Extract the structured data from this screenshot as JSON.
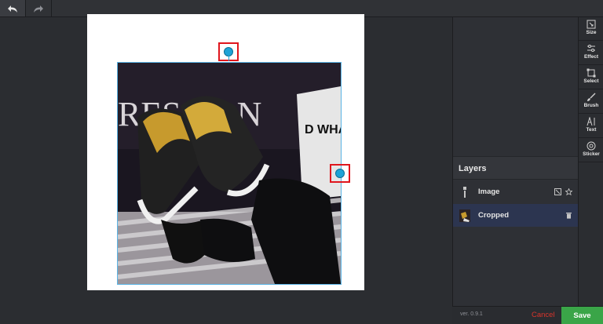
{
  "header": {
    "undo_icon": "undo-arrow-icon",
    "redo_icon": "redo-arrow-icon"
  },
  "canvas": {
    "photo_text_top": "RESSION",
    "photo_text_sign": "D WHA YOU LO"
  },
  "layers": {
    "title": "Layers",
    "items": [
      {
        "label": "Image"
      },
      {
        "label": "Cropped"
      }
    ]
  },
  "tools": [
    {
      "label": "Size",
      "icon": "size-icon"
    },
    {
      "label": "Effect",
      "icon": "effect-icon"
    },
    {
      "label": "Select",
      "icon": "select-icon"
    },
    {
      "label": "Brush",
      "icon": "brush-icon"
    },
    {
      "label": "Text",
      "icon": "text-icon"
    },
    {
      "label": "Sticker",
      "icon": "sticker-icon"
    }
  ],
  "footer": {
    "version": "ver. 0.9.1",
    "cancel_label": "Cancel",
    "save_label": "Save"
  },
  "colors": {
    "accent": "#1fa3d6",
    "save": "#3aa548",
    "cancel": "#d9342b",
    "highlight_box": "#e0161d"
  }
}
